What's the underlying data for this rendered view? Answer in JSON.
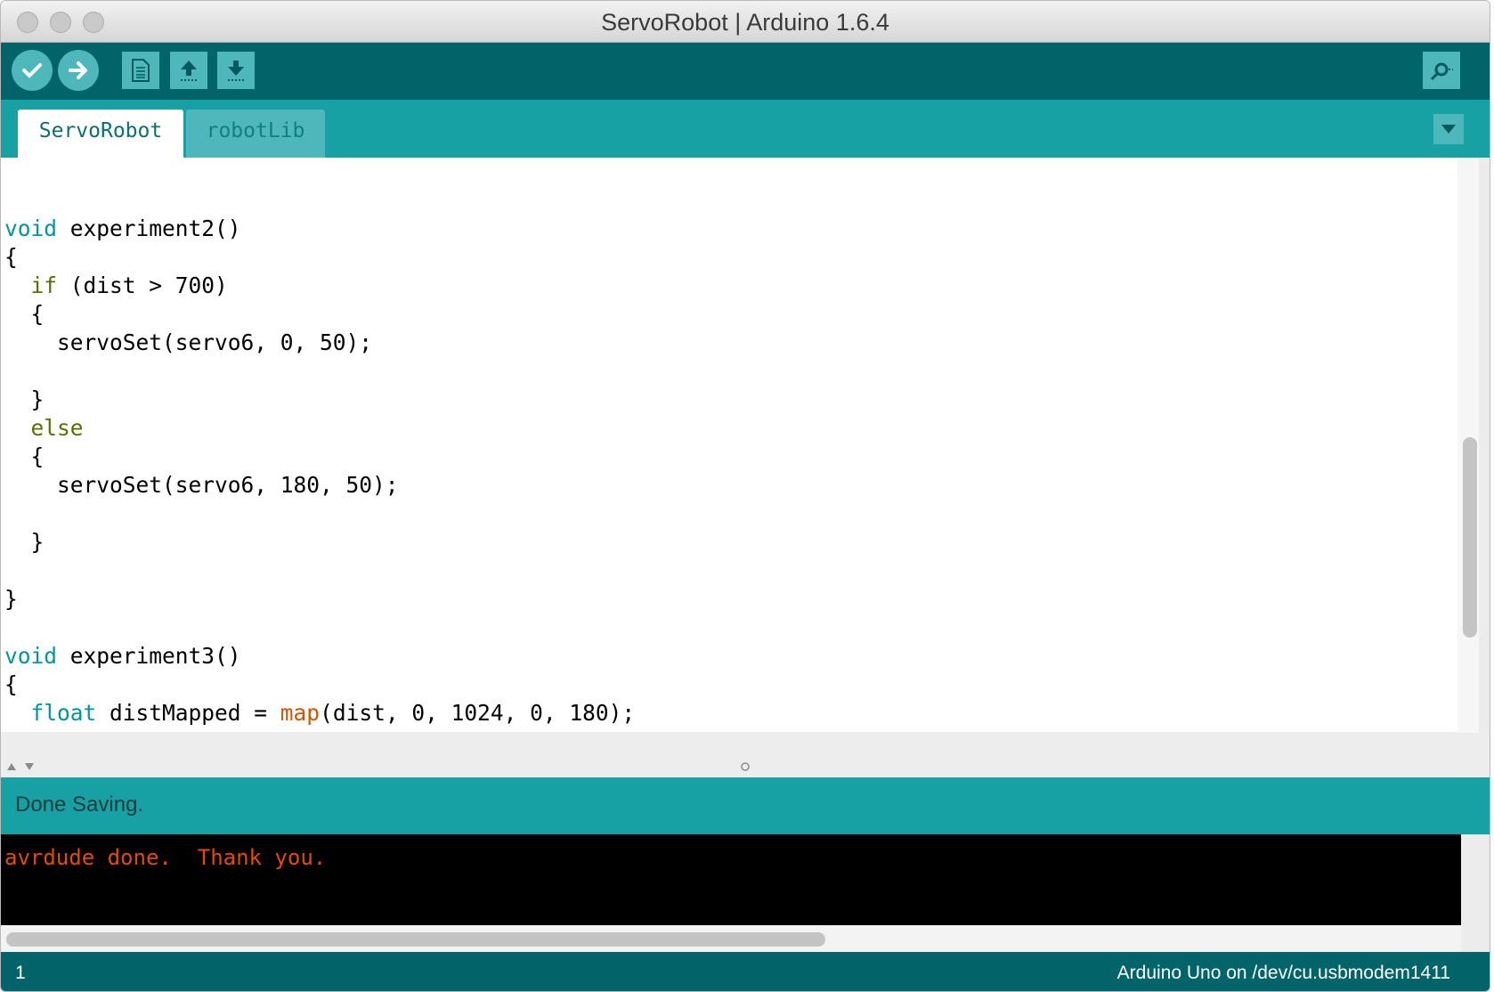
{
  "window": {
    "title": "ServoRobot | Arduino 1.6.4"
  },
  "toolbar": {
    "buttons": [
      {
        "name": "verify",
        "icon": "check-icon"
      },
      {
        "name": "upload",
        "icon": "arrow-right-icon"
      },
      {
        "name": "new",
        "icon": "new-file-icon"
      },
      {
        "name": "open",
        "icon": "open-up-arrow-icon"
      },
      {
        "name": "save",
        "icon": "save-down-arrow-icon"
      }
    ],
    "serial_monitor_icon": "magnifier-icon"
  },
  "tabs": [
    {
      "label": "ServoRobot",
      "active": true
    },
    {
      "label": "robotLib",
      "active": false
    }
  ],
  "editor": {
    "lines": [
      [],
      [],
      [
        {
          "t": "void",
          "c": "kw"
        },
        {
          "t": " experiment2()",
          "c": ""
        }
      ],
      [
        {
          "t": "{",
          "c": ""
        }
      ],
      [
        {
          "t": "  ",
          "c": ""
        },
        {
          "t": "if",
          "c": "kw2"
        },
        {
          "t": " (dist > 700)",
          "c": ""
        }
      ],
      [
        {
          "t": "  {",
          "c": ""
        }
      ],
      [
        {
          "t": "    servoSet(servo6, 0, 50);",
          "c": ""
        }
      ],
      [],
      [
        {
          "t": "  }",
          "c": ""
        }
      ],
      [
        {
          "t": "  ",
          "c": ""
        },
        {
          "t": "else",
          "c": "kw2"
        }
      ],
      [
        {
          "t": "  {",
          "c": ""
        }
      ],
      [
        {
          "t": "    servoSet(servo6, 180, 50);",
          "c": ""
        }
      ],
      [],
      [
        {
          "t": "  }",
          "c": ""
        }
      ],
      [],
      [
        {
          "t": "}",
          "c": ""
        }
      ],
      [],
      [
        {
          "t": "void",
          "c": "kw"
        },
        {
          "t": " experiment3()",
          "c": ""
        }
      ],
      [
        {
          "t": "{",
          "c": ""
        }
      ],
      [
        {
          "t": "  ",
          "c": ""
        },
        {
          "t": "float",
          "c": "kw"
        },
        {
          "t": " distMapped = ",
          "c": ""
        },
        {
          "t": "map",
          "c": "fn"
        },
        {
          "t": "(dist, 0, 1024, 0, 180);",
          "c": ""
        }
      ]
    ]
  },
  "status": {
    "message": "Done Saving."
  },
  "console": {
    "output": "avrdude done.  Thank you."
  },
  "footer": {
    "line_number": "1",
    "board": "Arduino Uno on /dev/cu.usbmodem1411"
  },
  "colors": {
    "toolbar_bg": "#006468",
    "tab_bar_bg": "#17a1a5",
    "keyword": "#00979c",
    "control": "#5e6d03",
    "function": "#d35400",
    "console_text": "#e34c00"
  }
}
